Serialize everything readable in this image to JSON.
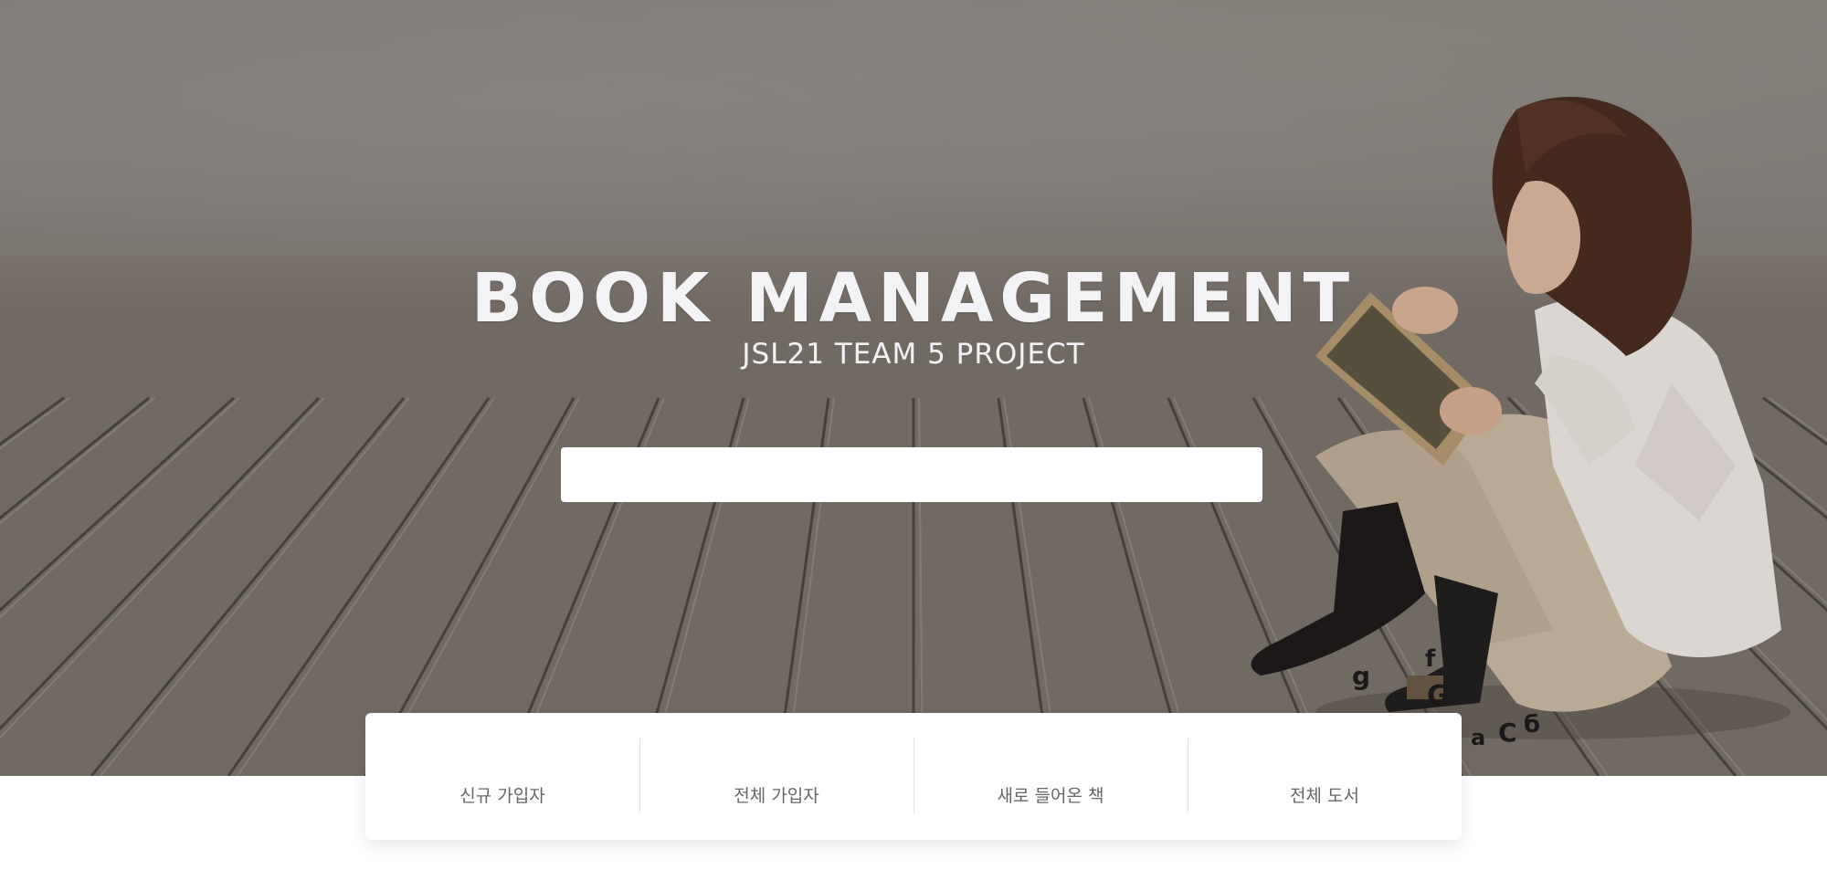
{
  "hero": {
    "title": "BOOK MANAGEMENT",
    "subtitle": "JSL21 TEAM 5 PROJECT",
    "background": "wooden-deck-girl-reading-photo"
  },
  "search": {
    "value": "",
    "placeholder": ""
  },
  "stats": {
    "items": [
      {
        "label": "신규 가입자"
      },
      {
        "label": "전체 가입자"
      },
      {
        "label": "새로 들어온 책"
      },
      {
        "label": "전체 도서"
      }
    ]
  },
  "colors": {
    "title_text": "#f3f3f5",
    "card_bg": "#ffffff",
    "label_text": "#666666"
  }
}
